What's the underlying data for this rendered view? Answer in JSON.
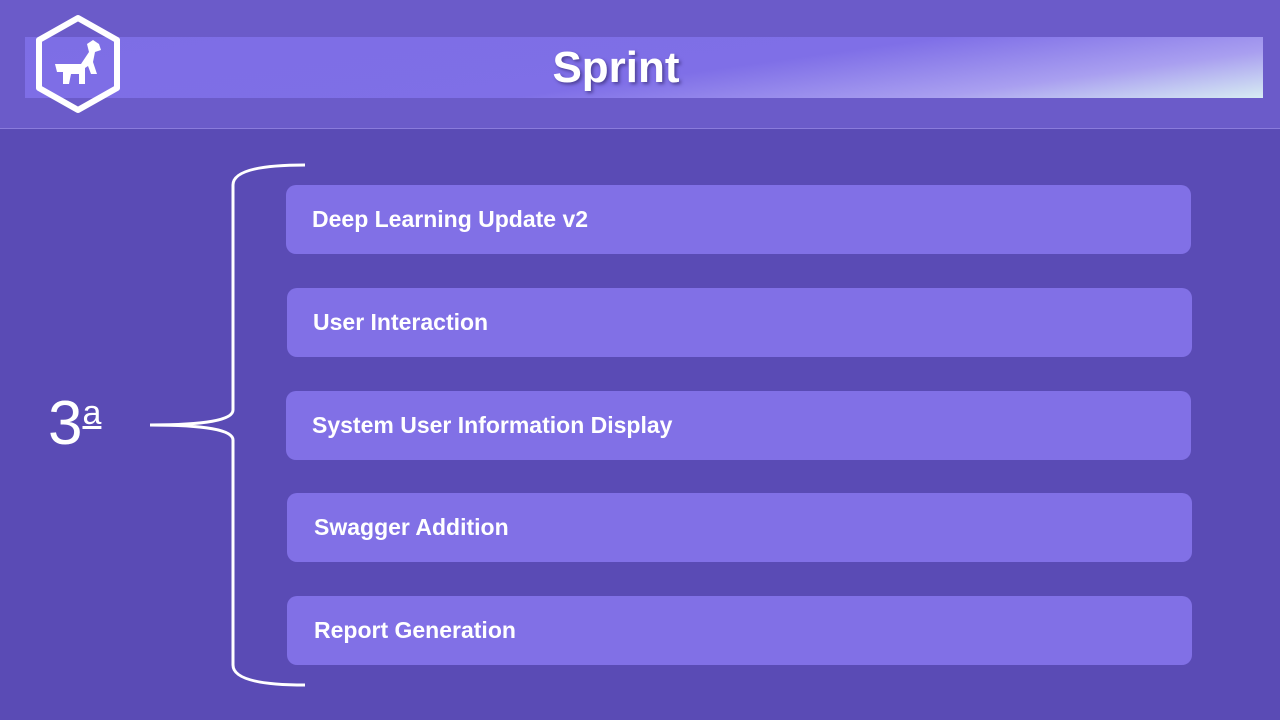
{
  "header": {
    "title": "Sprint",
    "logo_icon": "hexagon-animal-logo-icon"
  },
  "sprint": {
    "number": "3",
    "ordinal": "a"
  },
  "items": [
    {
      "label": "Deep Learning Update v2"
    },
    {
      "label": "User Interaction"
    },
    {
      "label": "System User Information Display"
    },
    {
      "label": "Swagger Addition"
    },
    {
      "label": "Report Generation"
    }
  ],
  "colors": {
    "background": "#5a4bb5",
    "header": "#6b5bc9",
    "item": "#8170e6",
    "text": "#ffffff"
  }
}
